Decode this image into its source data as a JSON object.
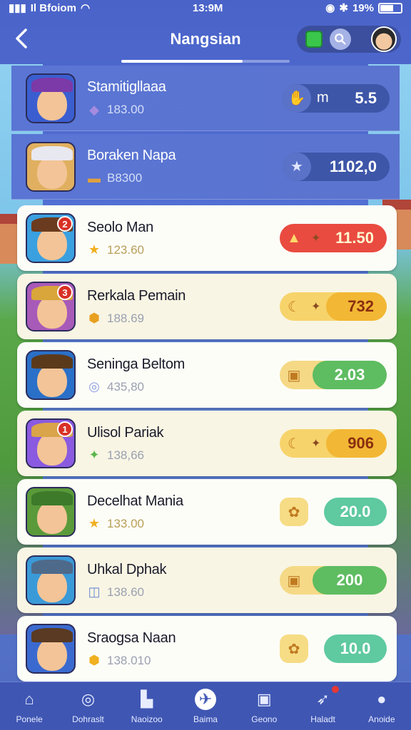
{
  "status_bar": {
    "carrier": "Il Bfoiom",
    "time": "13:9M",
    "battery": "19%"
  },
  "header": {
    "title": "Nangsian"
  },
  "rows": [
    {
      "name": "Stamitigllaaa",
      "sub": "183.00",
      "value": "5.5",
      "pill_prefix": "m",
      "style": "dark",
      "hat_color": "#7b3aa8",
      "badge": ""
    },
    {
      "name": "Boraken Napa",
      "sub": "B8300",
      "value": "1102,0",
      "style": "dark",
      "hat_color": "#e8e8f0",
      "badge": ""
    },
    {
      "name": "Seolo Man",
      "sub": "123.60",
      "value": "11.50",
      "style": "red",
      "hat_color": "#6b3b1f",
      "badge": "2"
    },
    {
      "name": "Rerkala Pemain",
      "sub": "188.69",
      "value": "732",
      "style": "yellow",
      "hat_color": "#d8a63a",
      "badge": "3"
    },
    {
      "name": "Seninga Beltom",
      "sub": "435,80",
      "value": "2.03",
      "style": "split",
      "hat_color": "#5b3a1c",
      "badge": ""
    },
    {
      "name": "Ulisol Pariak",
      "sub": "138,66",
      "value": "906",
      "style": "yellow",
      "hat_color": "#d9a44a",
      "badge": "1"
    },
    {
      "name": "Decelhat Mania",
      "sub": "133.00",
      "value": "20.0",
      "style": "teal",
      "hat_color": "#3d7a2a",
      "badge": ""
    },
    {
      "name": "Uhkal Dphak",
      "sub": "138.60",
      "value": "200",
      "style": "split",
      "hat_color": "#4e6a8a",
      "badge": ""
    },
    {
      "name": "Sraogsa Naan",
      "sub": "138.010",
      "value": "10.0",
      "style": "teal",
      "hat_color": "#5a3a22",
      "badge": ""
    }
  ],
  "nav": [
    {
      "label": "Ponele",
      "icon": "home-icon"
    },
    {
      "label": "Dohraslt",
      "icon": "compass-icon"
    },
    {
      "label": "Naoizoo",
      "icon": "shirt-icon"
    },
    {
      "label": "Baima",
      "icon": "plane-icon",
      "active": true
    },
    {
      "label": "Geono",
      "icon": "profile-card-icon"
    },
    {
      "label": "Haladt",
      "icon": "rocket-icon"
    },
    {
      "label": "Anoide",
      "icon": "person-icon"
    }
  ]
}
